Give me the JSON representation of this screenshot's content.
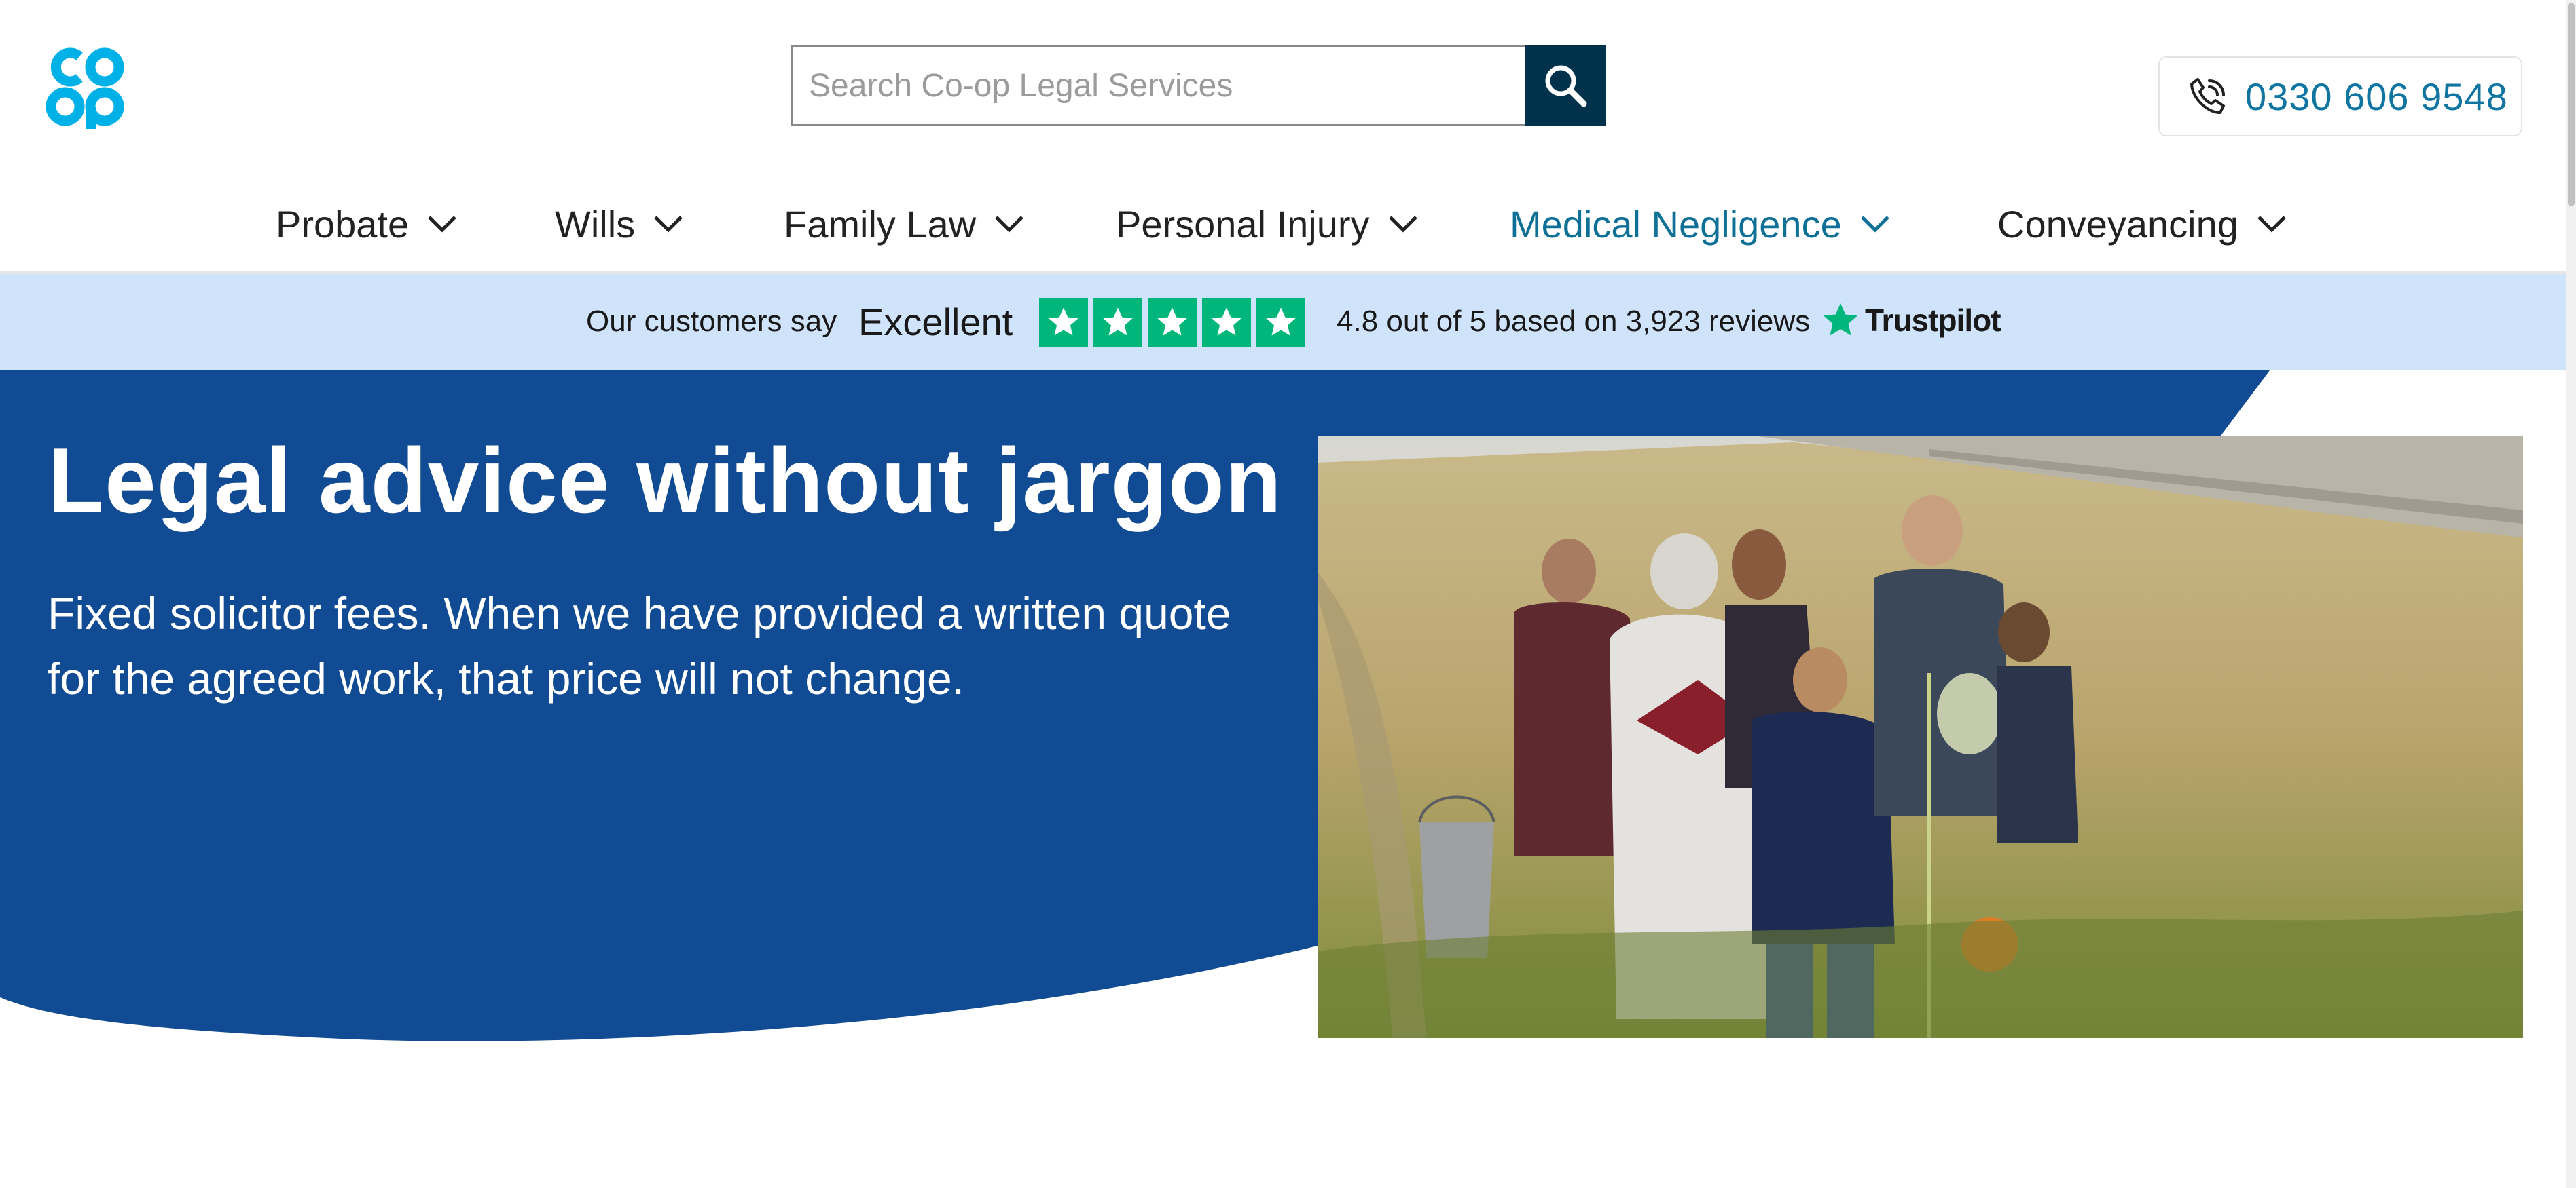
{
  "brand": {
    "logo_text_top": "co",
    "logo_text_bottom": "op",
    "color": "#00b1e7"
  },
  "search": {
    "placeholder": "Search Co-op Legal Services",
    "value": ""
  },
  "contact": {
    "phone": "0330 606 9548"
  },
  "nav": {
    "items": [
      {
        "label": "Probate",
        "active": false
      },
      {
        "label": "Wills",
        "active": false
      },
      {
        "label": "Family Law",
        "active": false
      },
      {
        "label": "Personal Injury",
        "active": false
      },
      {
        "label": "Medical Negligence",
        "active": true
      },
      {
        "label": "Conveyancing",
        "active": false
      }
    ]
  },
  "trustpilot": {
    "intro": "Our customers say",
    "rating_word": "Excellent",
    "stars": 5,
    "summary": "4.8 out of 5 based on 3,923 reviews",
    "brand": "Trustpilot",
    "star_color": "#00b67a"
  },
  "hero": {
    "title": "Legal advice without jargon",
    "subtitle": "Fixed solicitor fees. When we have provided a written quote for the agreed work, that price will not change.",
    "background_color": "#114b93"
  },
  "colors": {
    "trust_bar": "#cfe3fa",
    "search_button": "#00334b",
    "active_nav": "#0f7097"
  }
}
